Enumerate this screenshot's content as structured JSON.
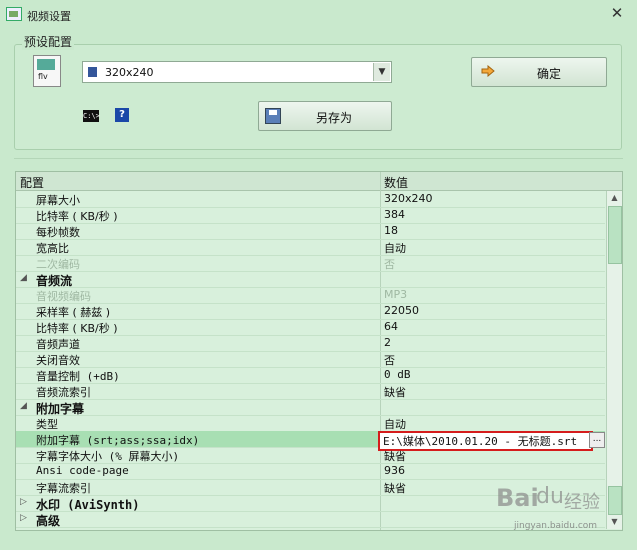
{
  "window": {
    "title": "视频设置",
    "close_glyph": "✕"
  },
  "preset": {
    "group_label": "预设配置",
    "file_badge": "flv",
    "combo_value": "320x240",
    "ok_label": "确定",
    "save_as_label": "另存为",
    "cmd_label": "C:\\>",
    "help_label": "?"
  },
  "grid": {
    "headers": [
      "配置",
      "数值"
    ],
    "rows": [
      {
        "key": "屏幕大小",
        "value": "320x240"
      },
      {
        "key": "比特率 ( KB/秒 )",
        "value": "384"
      },
      {
        "key": "每秒帧数",
        "value": "18"
      },
      {
        "key": "宽高比",
        "value": "自动"
      },
      {
        "key": "二次编码",
        "value": "否"
      },
      {
        "key": "音频流",
        "value": ""
      },
      {
        "key": "音视频编码",
        "value": "MP3"
      },
      {
        "key": "采样率 ( 赫兹 )",
        "value": "22050"
      },
      {
        "key": "比特率 ( KB/秒 )",
        "value": "64"
      },
      {
        "key": "音频声道",
        "value": "2"
      },
      {
        "key": "关闭音效",
        "value": "否"
      },
      {
        "key": "音量控制 (+dB)",
        "value": "0 dB"
      },
      {
        "key": "音频流索引",
        "value": "缺省"
      },
      {
        "key": "附加字幕",
        "value": ""
      },
      {
        "key": "类型",
        "value": "自动"
      },
      {
        "key": "附加字幕 (srt;ass;ssa;idx)",
        "value": "E:\\媒体\\2010.01.20 - 无标题.srt"
      },
      {
        "key": "字幕字体大小 (% 屏幕大小)",
        "value": "缺省"
      },
      {
        "key": "Ansi code-page",
        "value": "936"
      },
      {
        "key": "字幕流索引",
        "value": "缺省"
      },
      {
        "key": "水印 (AviSynth)",
        "value": ""
      },
      {
        "key": "高级",
        "value": ""
      }
    ],
    "browse_label": "..."
  },
  "watermark": {
    "logo": "Bai",
    "paw": "du",
    "brand": "经验",
    "url": "jingyan.baidu.com"
  },
  "colors": {
    "accent_red": "#d51c1c",
    "background": "#c9e9cd"
  }
}
